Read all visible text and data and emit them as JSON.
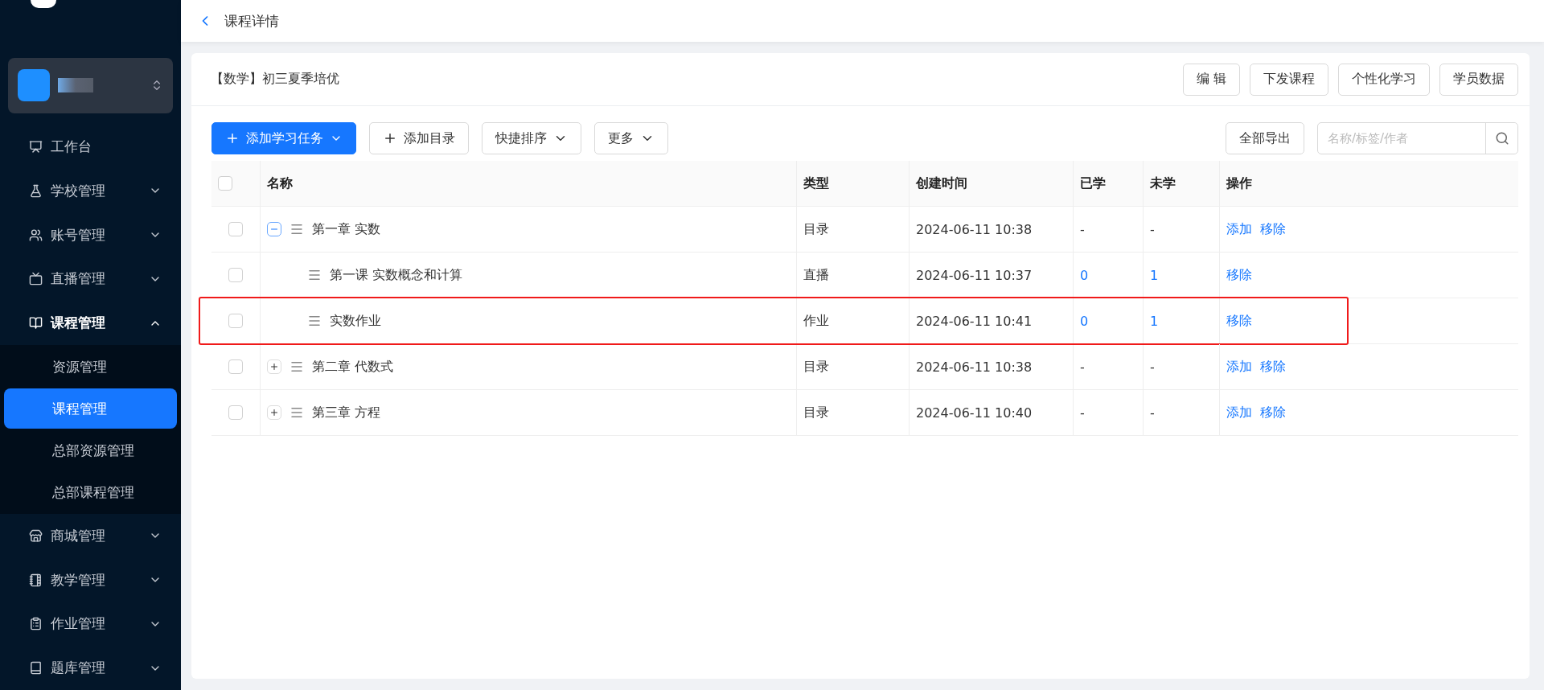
{
  "sidebar": {
    "items": [
      {
        "label": "工作台",
        "kind": "link"
      },
      {
        "label": "学校管理",
        "kind": "group",
        "expanded": false
      },
      {
        "label": "账号管理",
        "kind": "group",
        "expanded": false
      },
      {
        "label": "直播管理",
        "kind": "group",
        "expanded": false
      },
      {
        "label": "课程管理",
        "kind": "group",
        "expanded": true,
        "children": [
          {
            "label": "资源管理",
            "selected": false
          },
          {
            "label": "课程管理",
            "selected": true
          },
          {
            "label": "总部资源管理",
            "selected": false
          },
          {
            "label": "总部课程管理",
            "selected": false
          }
        ]
      },
      {
        "label": "商城管理",
        "kind": "group",
        "expanded": false
      },
      {
        "label": "教学管理",
        "kind": "group",
        "expanded": false
      },
      {
        "label": "作业管理",
        "kind": "group",
        "expanded": false
      },
      {
        "label": "题库管理",
        "kind": "group",
        "expanded": false
      }
    ]
  },
  "header": {
    "title": "课程详情"
  },
  "course": {
    "title": "【数学】初三夏季培优",
    "actions": [
      "编 辑",
      "下发课程",
      "个性化学习",
      "学员数据"
    ]
  },
  "toolbar": {
    "buttons": [
      {
        "label": "添加学习任务",
        "kind": "primary-menu"
      },
      {
        "label": "添加目录",
        "kind": "add"
      },
      {
        "label": "快捷排序",
        "kind": "menu"
      },
      {
        "label": "更多",
        "kind": "menu"
      }
    ],
    "export": "全部导出",
    "search": {
      "placeholder": "名称/标签/作者"
    }
  },
  "table": {
    "select_all": {
      "checked": false
    },
    "columns": [
      "名称",
      "类型",
      "创建时间",
      "已学",
      "未学",
      "操作"
    ],
    "rows": [
      {
        "kind": "directory",
        "name": "第一章 实数",
        "type": "目录",
        "created": "2024-06-11 10:38",
        "learned": "-",
        "unlearned": "-",
        "actions": [
          "添加",
          "移除"
        ],
        "expanded": true,
        "highlighted": false,
        "checked": false,
        "children": [
          {
            "kind": "task",
            "name": "第一课 实数概念和计算",
            "type": "直播",
            "created": "2024-06-11 10:37",
            "learned": "0",
            "unlearned": "1",
            "actions": [
              "移除"
            ],
            "highlighted": false,
            "checked": false
          },
          {
            "kind": "task",
            "name": "实数作业",
            "type": "作业",
            "created": "2024-06-11 10:41",
            "learned": "0",
            "unlearned": "1",
            "actions": [
              "移除"
            ],
            "highlighted": true,
            "checked": false
          }
        ]
      },
      {
        "kind": "directory",
        "name": "第二章 代数式",
        "type": "目录",
        "created": "2024-06-11 10:38",
        "learned": "-",
        "unlearned": "-",
        "actions": [
          "添加",
          "移除"
        ],
        "expanded": false,
        "highlighted": false,
        "checked": false
      },
      {
        "kind": "directory",
        "name": "第三章 方程",
        "type": "目录",
        "created": "2024-06-11 10:40",
        "learned": "-",
        "unlearned": "-",
        "actions": [
          "添加",
          "移除"
        ],
        "expanded": false,
        "highlighted": false,
        "checked": false
      }
    ]
  }
}
